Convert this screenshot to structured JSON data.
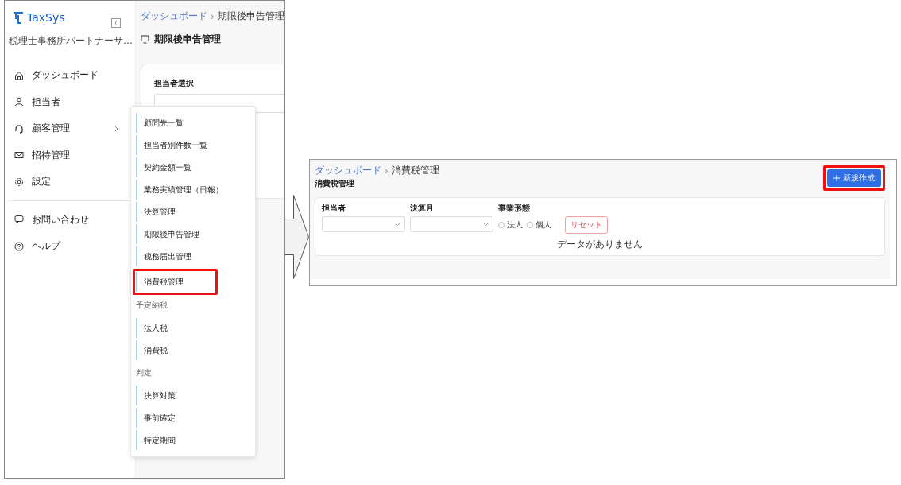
{
  "left_screen": {
    "sidebar": {
      "logo": "TaxSys",
      "subtitle": "税理士事務所パートナーサ…",
      "items": [
        {
          "label": "ダッシュボード",
          "has_submenu": false
        },
        {
          "label": "担当者",
          "has_submenu": false
        },
        {
          "label": "顧客管理",
          "has_submenu": true
        },
        {
          "label": "招待管理",
          "has_submenu": false
        },
        {
          "label": "設定",
          "has_submenu": false
        }
      ],
      "bottom_items": [
        {
          "label": "お問い合わせ"
        },
        {
          "label": "ヘルプ"
        }
      ]
    },
    "breadcrumb": [
      "ダッシュボード",
      "期限後申告管理"
    ],
    "breadcrumb_separator": "›",
    "title": "期限後申告管理",
    "card": {
      "label": "担当者選択"
    },
    "submenu": [
      {
        "kind": "item",
        "label": "顧問先一覧",
        "highlighted": false
      },
      {
        "kind": "item",
        "label": "担当者別件数一覧",
        "highlighted": false
      },
      {
        "kind": "item",
        "label": "契約金額一覧",
        "highlighted": false
      },
      {
        "kind": "item",
        "label": "業務実績管理（日報）",
        "highlighted": false
      },
      {
        "kind": "item",
        "label": "決算管理",
        "highlighted": false
      },
      {
        "kind": "item",
        "label": "期限後申告管理",
        "highlighted": false
      },
      {
        "kind": "item",
        "label": "税務届出管理",
        "highlighted": false
      },
      {
        "kind": "item",
        "label": "消費税管理",
        "highlighted": true
      },
      {
        "kind": "heading",
        "label": "予定納税"
      },
      {
        "kind": "item",
        "label": "法人税",
        "highlighted": false
      },
      {
        "kind": "item",
        "label": "消費税",
        "highlighted": false
      },
      {
        "kind": "heading",
        "label": "判定"
      },
      {
        "kind": "item",
        "label": "決算対策",
        "highlighted": false
      },
      {
        "kind": "item",
        "label": "事前確定",
        "highlighted": false
      },
      {
        "kind": "item",
        "label": "特定期間",
        "highlighted": false
      }
    ]
  },
  "right_screen": {
    "breadcrumb": [
      "ダッシュボード",
      "消費税管理"
    ],
    "breadcrumb_separator": "›",
    "title": "消費税管理",
    "new_button": {
      "label": "新規作成",
      "highlighted": true
    },
    "filters": [
      {
        "kind": "select",
        "label": "担当者"
      },
      {
        "kind": "select",
        "label": "決算月"
      },
      {
        "kind": "radio",
        "label": "事業形態",
        "options": [
          {
            "label": "法人",
            "checked": false
          },
          {
            "label": "個人",
            "checked": false
          }
        ]
      }
    ],
    "reset_button": "リセット",
    "empty_message": "データがありません"
  }
}
